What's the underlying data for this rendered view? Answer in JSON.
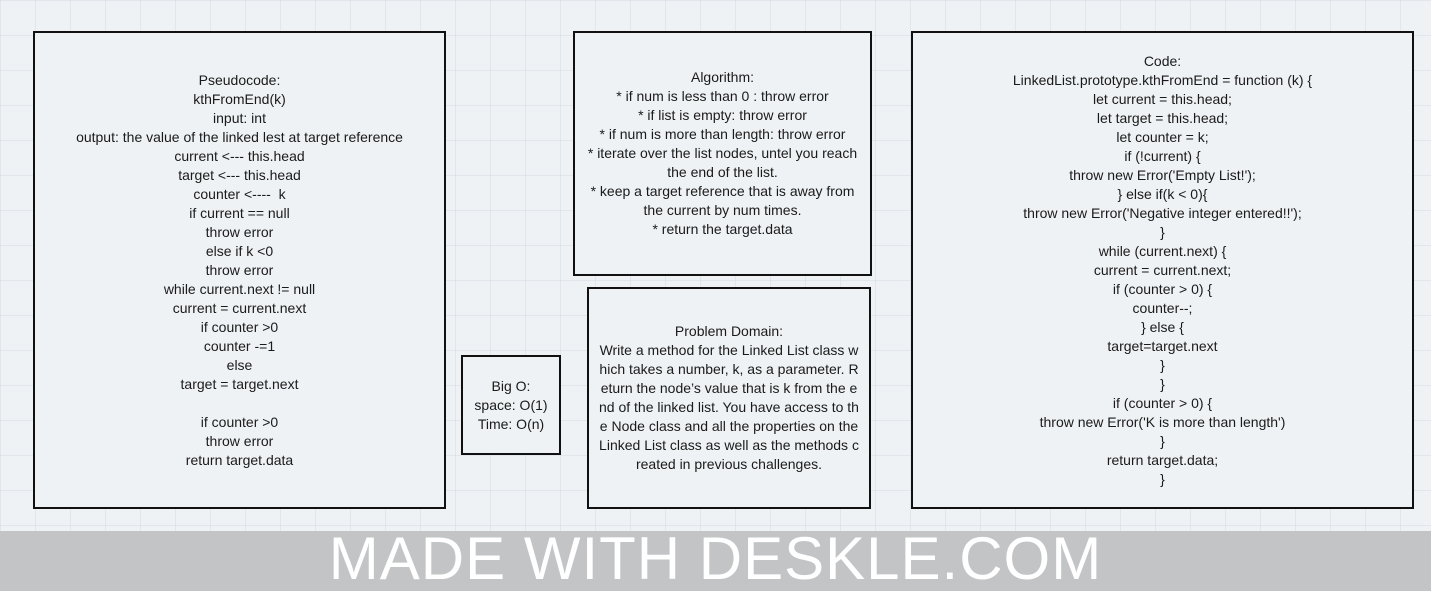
{
  "pseudocode": {
    "lines": [
      "Pseudocode:",
      "kthFromEnd(k)",
      "input: int",
      "output: the value of the linked lest at target reference",
      "current <--- this.head",
      "target <--- this.head",
      "counter <----  k",
      "if current == null",
      "throw error",
      "else if k <0",
      "throw error",
      "while current.next != null",
      "current = current.next",
      "if counter >0",
      "counter -=1",
      "else",
      "target = target.next",
      "",
      "if counter >0",
      "throw error",
      "return target.data"
    ]
  },
  "big_o": {
    "lines": [
      "Big O:",
      "space: O(1)",
      "Time: O(n)"
    ]
  },
  "algorithm": {
    "lines": [
      "Algorithm:",
      "* if num is less than 0 : throw error",
      "* if list is empty: throw error",
      "* if num is more than length: throw error",
      "* iterate over the list nodes, untel you reach the end of the list.",
      "* keep a target reference that is away from the current by num times.",
      "* return the target.data"
    ]
  },
  "problem_domain": {
    "lines": [
      "Problem Domain:",
      "Write a method for the Linked List class which takes a number, k, as a parameter. Return the node’s value that is k from the end of the linked list. You have access to the Node class and all the properties on the Linked List class as well as the methods created in previous challenges."
    ]
  },
  "code": {
    "lines": [
      "Code:",
      "LinkedList.prototype.kthFromEnd = function (k) {",
      "let current = this.head;",
      "let target = this.head;",
      "let counter = k;",
      "if (!current) {",
      "throw new Error('Empty List!');",
      "} else if(k < 0){",
      "throw new Error('Negative integer entered!!');",
      "}",
      "while (current.next) {",
      "current = current.next;",
      "if (counter > 0) {",
      "counter--;",
      "} else {",
      "target=target.next",
      "}",
      "}",
      "if (counter > 0) {",
      "throw new Error('K is more than length')",
      "}",
      "return target.data;",
      "}"
    ]
  },
  "watermark": {
    "text": "MADE WITH DESKLE.COM"
  }
}
